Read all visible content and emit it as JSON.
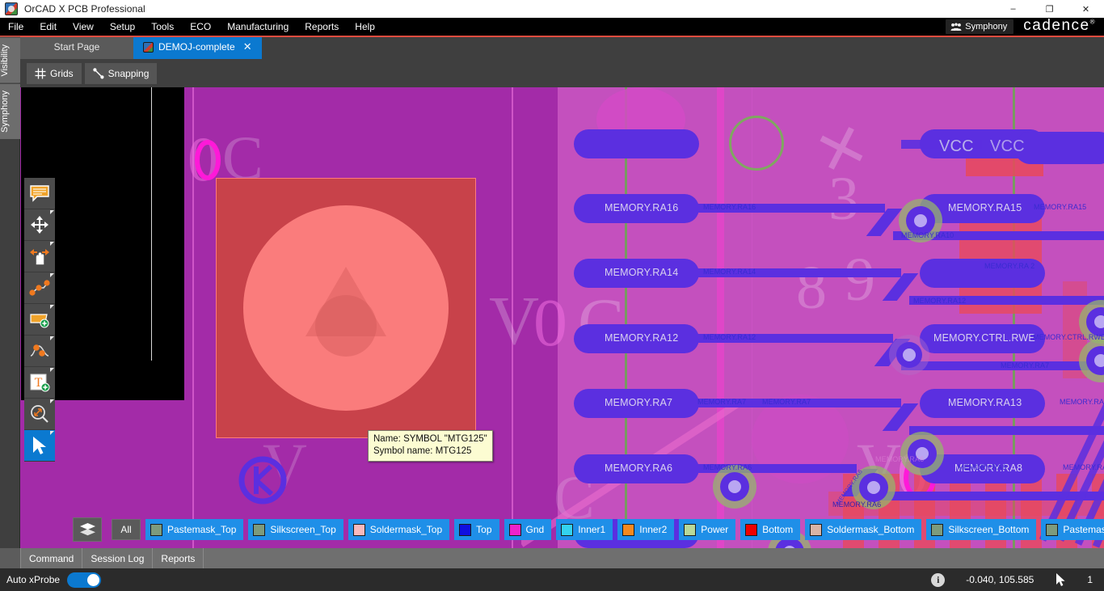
{
  "window": {
    "title": "OrCAD X PCB Professional",
    "logo_icon": "orcad-app-icon",
    "minimize_label": "–",
    "maximize_label": "❐",
    "close_label": "✕"
  },
  "menu": {
    "items": [
      "File",
      "Edit",
      "View",
      "Setup",
      "Tools",
      "ECO",
      "Manufacturing",
      "Reports",
      "Help"
    ],
    "symphony_label": "Symphony",
    "symphony_icon": "symphony-people-icon",
    "brand_label": "cadence",
    "brand_mark": "®"
  },
  "dock": {
    "tabs": [
      "Visibility",
      "Symphony"
    ]
  },
  "tabs": [
    {
      "label": "Start Page",
      "active": false,
      "closable": false,
      "icon": ""
    },
    {
      "label": "DEMOJ-complete",
      "active": true,
      "closable": true,
      "icon": "orcad-doc-icon",
      "close_glyph": "✕"
    }
  ],
  "toolbar": {
    "grids_label": "Grids",
    "grids_icon": "grid-hash-icon",
    "snapping_label": "Snapping",
    "snapping_icon": "snap-line-icon"
  },
  "palette": {
    "tools": [
      {
        "name": "comment-tool",
        "icon": "comment-balloon-icon",
        "selected": false,
        "has_flyout": false
      },
      {
        "name": "move-tool",
        "icon": "move-arrows-icon",
        "selected": false,
        "has_flyout": true
      },
      {
        "name": "drag-tool",
        "icon": "hand-drag-icon",
        "selected": false,
        "has_flyout": true
      },
      {
        "name": "route-tool",
        "icon": "route-connect-icon",
        "selected": false,
        "has_flyout": true
      },
      {
        "name": "add-shape-tool",
        "icon": "shape-add-icon",
        "selected": false,
        "has_flyout": true
      },
      {
        "name": "slide-tool",
        "icon": "slide-net-icon",
        "selected": false,
        "has_flyout": true
      },
      {
        "name": "add-text-tool",
        "icon": "text-add-icon",
        "selected": false,
        "has_flyout": true
      },
      {
        "name": "measure-tool",
        "icon": "magnifier-measure-icon",
        "selected": false,
        "has_flyout": true
      },
      {
        "name": "select-tool",
        "icon": "cursor-arrow-icon",
        "selected": true,
        "has_flyout": true
      }
    ]
  },
  "canvas": {
    "tooltip": {
      "line1": "Name: SYMBOL \"MTG125\"",
      "line2": "Symbol name: MTG125"
    },
    "component": {
      "symbol_name": "MTG125"
    },
    "net_labels_large": [
      "MEMORY.RA16",
      "MEMORY.RA14",
      "MEMORY.RA12",
      "MEMORY.RA7",
      "MEMORY.RA6",
      "VCC",
      "MEMORY.RA15",
      "MEMORY.CTRL.RWE",
      "MEMORY.RA13",
      "MEMORY.RA8"
    ],
    "net_labels_small": [
      "MEMORY.RA16",
      "MEMORY.RA14",
      "MEMORY.RA12",
      "MEMORY.RA7",
      "MEMORY.RA6",
      "MEMORY.RA15",
      "MEMORY.RA10",
      "MEMORY.RA 2",
      "MEMORY.RA7",
      "MEMORY.RA8",
      "MEMORY.RA12",
      "MEMORY.RA14",
      "MEMORY.RA6",
      "MEMORY.CTRL.RWE",
      "VCC"
    ],
    "silkscreen_text": [
      "0",
      "C",
      "V",
      "0",
      "C",
      "0"
    ]
  },
  "layerbar": {
    "stack_icon": "layer-stack-icon",
    "all_label": "All",
    "layers": [
      {
        "label": "Pastemask_Top",
        "color": "#7d9b7d"
      },
      {
        "label": "Silkscreen_Top",
        "color": "#7d9b7d"
      },
      {
        "label": "Soldermask_Top",
        "color": "#f7b9bd"
      },
      {
        "label": "Top",
        "color": "#1010e0"
      },
      {
        "label": "Gnd",
        "color": "#ee22cc"
      },
      {
        "label": "Inner1",
        "color": "#33d3f0"
      },
      {
        "label": "Inner2",
        "color": "#f5891f"
      },
      {
        "label": "Power",
        "color": "#b8d99a"
      },
      {
        "label": "Bottom",
        "color": "#f00000"
      },
      {
        "label": "Soldermask_Bottom",
        "color": "#d9b4a6"
      },
      {
        "label": "Silkscreen_Bottom",
        "color": "#7d9b7d"
      },
      {
        "label": "Pastemask_Bottom",
        "color": "#7d9b7d"
      }
    ]
  },
  "panels": {
    "tabs": [
      "Command",
      "Session Log",
      "Reports"
    ]
  },
  "status": {
    "auto_xprobe_label": "Auto xProbe",
    "auto_xprobe_on": true,
    "info_glyph": "i",
    "info_icon": "info-circle-icon",
    "coordinates": "-0.040, 105.585",
    "cursor_icon": "cursor-arrow-icon",
    "selection_count": "1"
  },
  "colors": {
    "accent_blue": "#0b79d0",
    "board_left": "#a32ba8",
    "board_right": "#c450be",
    "trace_purple": "#5b2fe0",
    "red_layer": "#e8485c",
    "green_line": "#6aa84f",
    "pink_line": "#e245c9",
    "tooltip_bg": "#fcfcd2",
    "title_red_rule": "#e04c3f"
  }
}
